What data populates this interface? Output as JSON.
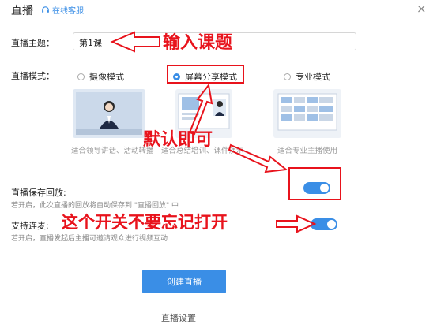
{
  "header": {
    "title": "直播",
    "service_label": "在线客服"
  },
  "topic": {
    "label": "直播主题：",
    "value": "第1课"
  },
  "mode": {
    "label": "直播模式：",
    "options": [
      {
        "label": "摄像模式",
        "caption": "适合领导讲话、活动转播",
        "selected": false
      },
      {
        "label": "屏幕分享模式",
        "caption": "适合总结培训、课件演示",
        "selected": true
      },
      {
        "label": "专业模式",
        "caption": "适合专业主播使用",
        "selected": false
      }
    ]
  },
  "save_replay": {
    "label": "直播保存回放:",
    "hint": "若开启，此次直播的回放将自动保存到 \"直播回放\" 中",
    "enabled": true
  },
  "co_host": {
    "label": "支持连麦:",
    "hint": "若开启，直播发起后主播可邀请观众进行视频互动",
    "enabled": true
  },
  "create_button": "创建直播",
  "footer": "直播设置",
  "annotations": {
    "input_topic": "输入课题",
    "default_ok": "默认即可",
    "remember_toggle": "这个开关不要忘记打开"
  },
  "colors": {
    "accent": "#3a8ee6",
    "annotation": "#e8131c"
  },
  "icons": {
    "service": "headset-icon",
    "close": "close-icon"
  }
}
